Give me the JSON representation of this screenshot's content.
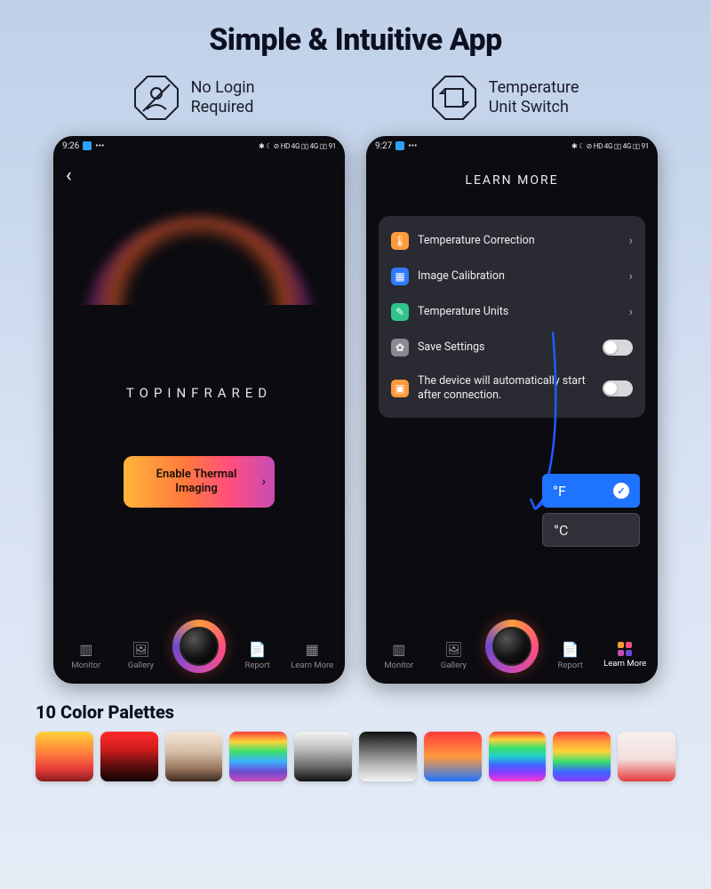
{
  "headline": "Simple & Intuitive App",
  "features": {
    "noLogin": {
      "line1": "No Login",
      "line2": "Required"
    },
    "tempSwitch": {
      "line1": "Temperature",
      "line2": "Unit Switch"
    }
  },
  "statusbar": {
    "time_left": "9:26",
    "time_right": "9:27",
    "icons_text": "✱ ☾ ⊘ HD 4G ▯▯ 4G ▯▯ 91"
  },
  "phone1": {
    "brand": "TOPINFRARED",
    "cta": "Enable Thermal Imaging"
  },
  "phone2": {
    "title": "LEARN MORE",
    "settings": [
      {
        "icon_bg": "#ff9a3c",
        "glyph": "🌡",
        "label": "Temperature Correction",
        "type": "chevron"
      },
      {
        "icon_bg": "#2f7bff",
        "glyph": "▦",
        "label": "Image Calibration",
        "type": "chevron"
      },
      {
        "icon_bg": "#2fc48b",
        "glyph": "✎",
        "label": "Temperature Units",
        "type": "chevron"
      },
      {
        "icon_bg": "#8a8a92",
        "glyph": "✿",
        "label": "Save Settings",
        "type": "toggle"
      },
      {
        "icon_bg": "#ff9a3c",
        "glyph": "▣",
        "label": "The device will automatically start after connection.",
        "type": "toggle"
      }
    ],
    "units": {
      "f": "°F",
      "c": "°C"
    }
  },
  "nav": {
    "items": [
      "Monitor",
      "Gallery",
      "",
      "Report",
      "Learn More"
    ]
  },
  "palettes_title": "10 Color Palettes",
  "palettes": [
    "linear-gradient(180deg,#ffd23a 0%,#ff7a3c 45%,#e63b3b 75%,#8a1d1d 100%)",
    "linear-gradient(180deg,#ff2a2a 0%,#d01c1c 35%,#5a0e0e 70%,#120303 100%)",
    "linear-gradient(180deg,#f5e6da 0%,#d7bfa8 40%,#96745c 75%,#3b2a1f 100%)",
    "linear-gradient(180deg,#ff3b3b 0%,#ffd23a 20%,#3be06a 40%,#3bb0ff 60%,#6a4bd0 80%,#c84bb5 100%)",
    "linear-gradient(180deg,#f4f4f4 0%,#bdbdbd 35%,#6a6a6a 70%,#111 100%)",
    "linear-gradient(180deg,#111 0%,#6a6a6a 35%,#bdbdbd 70%,#f4f4f4 100%)",
    "linear-gradient(180deg,#ff3b3b 0%,#ff9a3c 50%,#1f74ff 100%)",
    "linear-gradient(180deg,#ff3b3b 0%,#ffd23a 16%,#3be06a 33%,#20d0d0 50%,#3b6aff 66%,#8a3bff 83%,#ff3bd0 100%)",
    "linear-gradient(180deg,#ff3b3b 0%,#ff9a3c 20%,#ffd23a 40%,#3be06a 60%,#3b6aff 80%,#8a3bff 100%)",
    "linear-gradient(180deg,#f7f0ef 0%,#f2dedc 55%,#e43b3b 100%)"
  ]
}
